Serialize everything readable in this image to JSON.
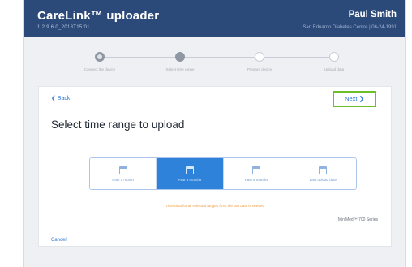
{
  "header": {
    "app_title": "CareLink™ uploader",
    "app_version": "1.2.9.6.0_2018T15:01",
    "user_name": "Paul Smith",
    "user_clinic": "San Eduardo Diabetes Centre | 06-24-1991"
  },
  "stepper": {
    "steps": [
      {
        "label": "Connect the device",
        "state": "done"
      },
      {
        "label": "Select time range",
        "state": "current"
      },
      {
        "label": "Prepare device",
        "state": "pending"
      },
      {
        "label": "Upload data",
        "state": "pending"
      }
    ]
  },
  "card": {
    "back_label": "❮ Back",
    "next_label": "Next ❯",
    "heading": "Select time range to upload",
    "range_options": [
      {
        "label": "Past 1 month",
        "selected": false
      },
      {
        "label": "Past 3 months",
        "selected": true
      },
      {
        "label": "Past 6 months",
        "selected": false
      },
      {
        "label": "Last upload date",
        "selected": false
      }
    ],
    "warning": "Time data for all selected ranges from the last date is needed",
    "device_name": "MiniMed™ 700 Series",
    "cancel_label": "Cancel"
  },
  "colors": {
    "header_bg": "#2b4a7a",
    "accent_blue": "#2f82d9",
    "highlight_green": "#6cbf2a",
    "warning_orange": "#ee9d3c"
  },
  "icons": {
    "back": "chevron-left-icon",
    "next": "chevron-right-icon",
    "range": "calendar-icon"
  }
}
